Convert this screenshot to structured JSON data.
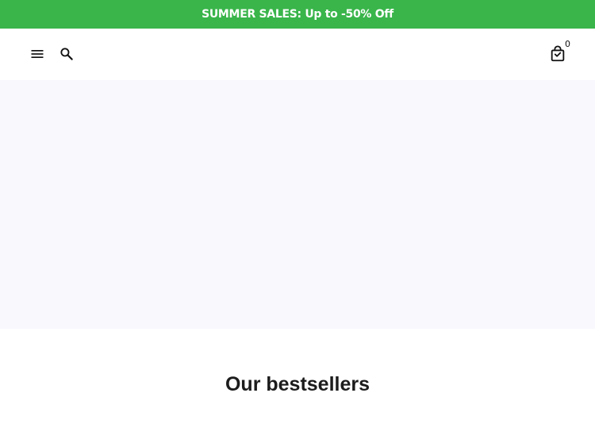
{
  "announcement": {
    "text": "SUMMER SALES: Up to -50% Off",
    "background": "#39b54a"
  },
  "header": {
    "menu_icon": "hamburger-menu-icon",
    "search_icon": "search-icon",
    "cart_icon": "shopping-bag-icon",
    "cart_count": "0"
  },
  "hero": {
    "background": "#f8f8fd"
  },
  "bestsellers": {
    "title": "Our bestsellers"
  }
}
